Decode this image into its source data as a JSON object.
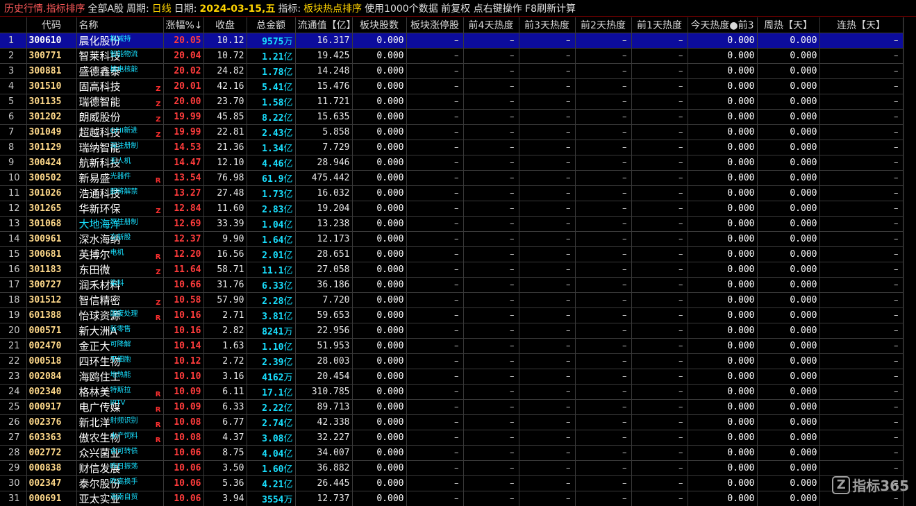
{
  "titlebar": {
    "history": "历史行情.指标排序",
    "market": "全部A股",
    "period_label": "周期:",
    "period": "日线",
    "date_label": "日期:",
    "date": "2024-03-15,五",
    "indicator_label": "指标:",
    "indicator": "板块热点排序",
    "hint": "使用1000个数据 前复权 点右键操作 F8刷新计算"
  },
  "columns": [
    "",
    "代码",
    "名称",
    "涨幅%↓",
    "收盘",
    "总金额",
    "流通值【亿】",
    "板块股数",
    "板块涨停股",
    "前4天热度",
    "前3天热度",
    "前2天热度",
    "前1天热度",
    "今天热度●前3",
    "周热【天】",
    "连热【天】"
  ],
  "rows": [
    {
      "idx": "1",
      "code": "300610",
      "name": "晨化股份",
      "tag": "拟减持",
      "flag": "",
      "chg": "20.05",
      "close": "10.12",
      "amt": "9575",
      "unit": "万",
      "cap": "16.317",
      "bk": "0.000",
      "zt": "–",
      "d4": "–",
      "d3": "–",
      "d2": "–",
      "d1": "–",
      "today": "0.000",
      "week": "0.000",
      "lian": "–",
      "selected": true
    },
    {
      "idx": "2",
      "code": "300771",
      "name": "智莱科技",
      "tag": "智能物流",
      "flag": "",
      "chg": "20.04",
      "close": "10.72",
      "amt": "1.21",
      "unit": "亿",
      "cap": "19.425",
      "bk": "0.000",
      "zt": "–",
      "d4": "–",
      "d3": "–",
      "d2": "–",
      "d1": "–",
      "today": "0.000",
      "week": "0.000",
      "lian": "–"
    },
    {
      "idx": "3",
      "code": "300881",
      "name": "盛德鑫泰",
      "tag": "核电核能",
      "flag": "",
      "chg": "20.02",
      "close": "24.82",
      "amt": "1.78",
      "unit": "亿",
      "cap": "14.248",
      "bk": "0.000",
      "zt": "–",
      "d4": "–",
      "d3": "–",
      "d2": "–",
      "d1": "–",
      "today": "0.000",
      "week": "0.000",
      "lian": "–"
    },
    {
      "idx": "4",
      "code": "301510",
      "name": "固高科技",
      "tag": "",
      "flag": "Z",
      "chg": "20.01",
      "close": "42.16",
      "amt": "5.41",
      "unit": "亿",
      "cap": "15.476",
      "bk": "0.000",
      "zt": "–",
      "d4": "–",
      "d3": "–",
      "d2": "–",
      "d1": "–",
      "today": "0.000",
      "week": "0.000",
      "lian": "–"
    },
    {
      "idx": "5",
      "code": "301135",
      "name": "瑞德智能",
      "tag": "",
      "flag": "Z",
      "chg": "20.00",
      "close": "23.70",
      "amt": "1.58",
      "unit": "亿",
      "cap": "11.721",
      "bk": "0.000",
      "zt": "–",
      "d4": "–",
      "d3": "–",
      "d2": "–",
      "d1": "–",
      "today": "0.000",
      "week": "0.000",
      "lian": "–"
    },
    {
      "idx": "6",
      "code": "301202",
      "name": "朗威股份",
      "tag": "",
      "flag": "Z",
      "chg": "19.99",
      "close": "45.85",
      "amt": "8.22",
      "unit": "亿",
      "cap": "15.635",
      "bk": "0.000",
      "zt": "–",
      "d4": "–",
      "d3": "–",
      "d2": "–",
      "d1": "–",
      "today": "0.000",
      "week": "0.000",
      "lian": "–"
    },
    {
      "idx": "7",
      "code": "301049",
      "name": "超越科技",
      "tag": "QFII新进",
      "flag": "Z",
      "chg": "19.99",
      "close": "22.81",
      "amt": "2.43",
      "unit": "亿",
      "cap": "5.858",
      "bk": "0.000",
      "zt": "–",
      "d4": "–",
      "d3": "–",
      "d2": "–",
      "d1": "–",
      "today": "0.000",
      "week": "0.000",
      "lian": "–"
    },
    {
      "idx": "8",
      "code": "301129",
      "name": "瑞纳智能",
      "tag": "深注册制",
      "flag": "",
      "chg": "14.53",
      "close": "21.36",
      "amt": "1.34",
      "unit": "亿",
      "cap": "7.729",
      "bk": "0.000",
      "zt": "–",
      "d4": "–",
      "d3": "–",
      "d2": "–",
      "d1": "–",
      "today": "0.000",
      "week": "0.000",
      "lian": "–"
    },
    {
      "idx": "9",
      "code": "300424",
      "name": "航新科技",
      "tag": "无人机",
      "flag": "",
      "chg": "14.47",
      "close": "12.10",
      "amt": "4.46",
      "unit": "亿",
      "cap": "28.946",
      "bk": "0.000",
      "zt": "–",
      "d4": "–",
      "d3": "–",
      "d2": "–",
      "d1": "–",
      "today": "0.000",
      "week": "0.000",
      "lian": "–"
    },
    {
      "idx": "10",
      "code": "300502",
      "name": "新易盛",
      "tag": "光器件",
      "flag": "R",
      "chg": "13.54",
      "close": "76.98",
      "amt": "61.9",
      "unit": "亿",
      "cap": "475.442",
      "bk": "0.000",
      "zt": "–",
      "d4": "–",
      "d3": "–",
      "d2": "–",
      "d1": "–",
      "today": "0.000",
      "week": "0.000",
      "lian": "–"
    },
    {
      "idx": "11",
      "code": "301026",
      "name": "浩通科技",
      "tag": "即将解禁",
      "flag": "",
      "chg": "13.27",
      "close": "27.48",
      "amt": "1.73",
      "unit": "亿",
      "cap": "16.032",
      "bk": "0.000",
      "zt": "–",
      "d4": "–",
      "d3": "–",
      "d2": "–",
      "d1": "–",
      "today": "0.000",
      "week": "0.000",
      "lian": "–"
    },
    {
      "idx": "12",
      "code": "301265",
      "name": "华新环保",
      "tag": "",
      "flag": "Z",
      "chg": "12.84",
      "close": "11.60",
      "amt": "2.83",
      "unit": "亿",
      "cap": "19.204",
      "bk": "0.000",
      "zt": "–",
      "d4": "–",
      "d3": "–",
      "d2": "–",
      "d1": "–",
      "today": "0.000",
      "week": "0.000",
      "lian": "–"
    },
    {
      "idx": "13",
      "code": "301068",
      "name": "大地海洋",
      "tag": "深注册制",
      "flag": "",
      "chg": "12.69",
      "close": "33.39",
      "amt": "1.04",
      "unit": "亿",
      "cap": "13.238",
      "bk": "0.000",
      "zt": "–",
      "d4": "–",
      "d3": "–",
      "d2": "–",
      "d1": "–",
      "today": "0.000",
      "week": "0.000",
      "lian": "–",
      "cyan": true
    },
    {
      "idx": "14",
      "code": "300961",
      "name": "深水海纳",
      "tag": "次新股",
      "flag": "",
      "chg": "12.37",
      "close": "9.90",
      "amt": "1.64",
      "unit": "亿",
      "cap": "12.173",
      "bk": "0.000",
      "zt": "–",
      "d4": "–",
      "d3": "–",
      "d2": "–",
      "d1": "–",
      "today": "0.000",
      "week": "0.000",
      "lian": "–"
    },
    {
      "idx": "15",
      "code": "300681",
      "name": "英搏尔",
      "tag": "电机",
      "flag": "R",
      "chg": "12.20",
      "close": "16.56",
      "amt": "2.01",
      "unit": "亿",
      "cap": "28.651",
      "bk": "0.000",
      "zt": "–",
      "d4": "–",
      "d3": "–",
      "d2": "–",
      "d1": "–",
      "today": "0.000",
      "week": "0.000",
      "lian": "–"
    },
    {
      "idx": "16",
      "code": "301183",
      "name": "东田微",
      "tag": "",
      "flag": "Z",
      "chg": "11.64",
      "close": "58.71",
      "amt": "11.1",
      "unit": "亿",
      "cap": "27.058",
      "bk": "0.000",
      "zt": "–",
      "d4": "–",
      "d3": "–",
      "d2": "–",
      "d1": "–",
      "today": "0.000",
      "week": "0.000",
      "lian": "–"
    },
    {
      "idx": "17",
      "code": "300727",
      "name": "润禾材料",
      "tag": "染料",
      "flag": "",
      "chg": "10.66",
      "close": "31.76",
      "amt": "6.33",
      "unit": "亿",
      "cap": "36.186",
      "bk": "0.000",
      "zt": "–",
      "d4": "–",
      "d3": "–",
      "d2": "–",
      "d1": "–",
      "today": "0.000",
      "week": "0.000",
      "lian": "–"
    },
    {
      "idx": "18",
      "code": "301512",
      "name": "智信精密",
      "tag": "",
      "flag": "Z",
      "chg": "10.58",
      "close": "57.90",
      "amt": "2.28",
      "unit": "亿",
      "cap": "7.720",
      "bk": "0.000",
      "zt": "–",
      "d4": "–",
      "d3": "–",
      "d2": "–",
      "d1": "–",
      "today": "0.000",
      "week": "0.000",
      "lian": "–"
    },
    {
      "idx": "19",
      "code": "601388",
      "name": "怡球资源",
      "tag": "固废处理",
      "flag": "R",
      "chg": "10.16",
      "close": "2.71",
      "amt": "3.81",
      "unit": "亿",
      "cap": "59.653",
      "bk": "0.000",
      "zt": "–",
      "d4": "–",
      "d3": "–",
      "d2": "–",
      "d1": "–",
      "today": "0.000",
      "week": "0.000",
      "lian": "–"
    },
    {
      "idx": "20",
      "code": "000571",
      "name": "新大洲A",
      "tag": "新零售",
      "flag": "",
      "chg": "10.16",
      "close": "2.82",
      "amt": "8241",
      "unit": "万",
      "cap": "22.956",
      "bk": "0.000",
      "zt": "–",
      "d4": "–",
      "d3": "–",
      "d2": "–",
      "d1": "–",
      "today": "0.000",
      "week": "0.000",
      "lian": "–"
    },
    {
      "idx": "21",
      "code": "002470",
      "name": "金正大",
      "tag": "可降解",
      "flag": "",
      "chg": "10.14",
      "close": "1.63",
      "amt": "1.10",
      "unit": "亿",
      "cap": "51.953",
      "bk": "0.000",
      "zt": "–",
      "d4": "–",
      "d3": "–",
      "d2": "–",
      "d1": "–",
      "today": "0.000",
      "week": "0.000",
      "lian": "–"
    },
    {
      "idx": "22",
      "code": "000518",
      "name": "四环生物",
      "tag": "干细胞",
      "flag": "",
      "chg": "10.12",
      "close": "2.72",
      "amt": "2.39",
      "unit": "亿",
      "cap": "28.003",
      "bk": "0.000",
      "zt": "–",
      "d4": "–",
      "d3": "–",
      "d2": "–",
      "d1": "–",
      "today": "0.000",
      "week": "0.000",
      "lian": "–"
    },
    {
      "idx": "23",
      "code": "002084",
      "name": "海鸥住工",
      "tag": "地热能",
      "flag": "",
      "chg": "10.10",
      "close": "3.16",
      "amt": "4162",
      "unit": "万",
      "cap": "20.454",
      "bk": "0.000",
      "zt": "–",
      "d4": "–",
      "d3": "–",
      "d2": "–",
      "d1": "–",
      "today": "0.000",
      "week": "0.000",
      "lian": "–"
    },
    {
      "idx": "24",
      "code": "002340",
      "name": "格林美",
      "tag": "特斯拉",
      "flag": "R",
      "chg": "10.09",
      "close": "6.11",
      "amt": "17.1",
      "unit": "亿",
      "cap": "310.785",
      "bk": "0.000",
      "zt": "–",
      "d4": "–",
      "d3": "–",
      "d2": "–",
      "d1": "–",
      "today": "0.000",
      "week": "0.000",
      "lian": "–"
    },
    {
      "idx": "25",
      "code": "000917",
      "name": "电广传媒",
      "tag": "IPTV",
      "flag": "R",
      "chg": "10.09",
      "close": "6.33",
      "amt": "2.22",
      "unit": "亿",
      "cap": "89.713",
      "bk": "0.000",
      "zt": "–",
      "d4": "–",
      "d3": "–",
      "d2": "–",
      "d1": "–",
      "today": "0.000",
      "week": "0.000",
      "lian": "–"
    },
    {
      "idx": "26",
      "code": "002376",
      "name": "新北洋",
      "tag": "射频识别",
      "flag": "R",
      "chg": "10.08",
      "close": "6.77",
      "amt": "2.74",
      "unit": "亿",
      "cap": "42.338",
      "bk": "0.000",
      "zt": "–",
      "d4": "–",
      "d3": "–",
      "d2": "–",
      "d1": "–",
      "today": "0.000",
      "week": "0.000",
      "lian": "–"
    },
    {
      "idx": "27",
      "code": "603363",
      "name": "傲农生物",
      "tag": "水产饲料",
      "flag": "R",
      "chg": "10.08",
      "close": "4.37",
      "amt": "3.08",
      "unit": "亿",
      "cap": "32.227",
      "bk": "0.000",
      "zt": "–",
      "d4": "–",
      "d3": "–",
      "d2": "–",
      "d1": "–",
      "today": "0.000",
      "week": "0.000",
      "lian": "–"
    },
    {
      "idx": "28",
      "code": "002772",
      "name": "众兴菌业",
      "tag": "含可转债",
      "flag": "",
      "chg": "10.06",
      "close": "8.75",
      "amt": "4.04",
      "unit": "亿",
      "cap": "34.007",
      "bk": "0.000",
      "zt": "–",
      "d4": "–",
      "d3": "–",
      "d2": "–",
      "d1": "–",
      "today": "0.000",
      "week": "0.000",
      "lian": "–"
    },
    {
      "idx": "29",
      "code": "000838",
      "name": "财信发展",
      "tag": "昨日振荡",
      "flag": "",
      "chg": "10.06",
      "close": "3.50",
      "amt": "1.60",
      "unit": "亿",
      "cap": "36.882",
      "bk": "0.000",
      "zt": "–",
      "d4": "–",
      "d3": "–",
      "d2": "–",
      "d1": "–",
      "today": "0.000",
      "week": "0.000",
      "lian": "–"
    },
    {
      "idx": "30",
      "code": "002347",
      "name": "泰尔股份",
      "tag": "昨高换手",
      "flag": "",
      "chg": "10.06",
      "close": "5.36",
      "amt": "4.21",
      "unit": "亿",
      "cap": "26.445",
      "bk": "0.000",
      "zt": "–",
      "d4": "–",
      "d3": "–",
      "d2": "–",
      "d1": "–",
      "today": "0.000",
      "week": "0.000",
      "lian": "–"
    },
    {
      "idx": "31",
      "code": "000691",
      "name": "亚太实业",
      "tag": "海南自贸",
      "flag": "",
      "chg": "10.06",
      "close": "3.94",
      "amt": "3554",
      "unit": "万",
      "cap": "12.737",
      "bk": "0.000",
      "zt": "–",
      "d4": "–",
      "d3": "–",
      "d2": "–",
      "d1": "–",
      "today": "0.000",
      "week": "0.000",
      "lian": "–"
    }
  ],
  "watermark": {
    "logo": "Z",
    "text": "指标365"
  },
  "colors": {
    "accent_red": "#ff3c3c",
    "code_yellow": "#ffd98a",
    "cyan": "#18e0ff",
    "selected_row": "#0c0c9c"
  }
}
